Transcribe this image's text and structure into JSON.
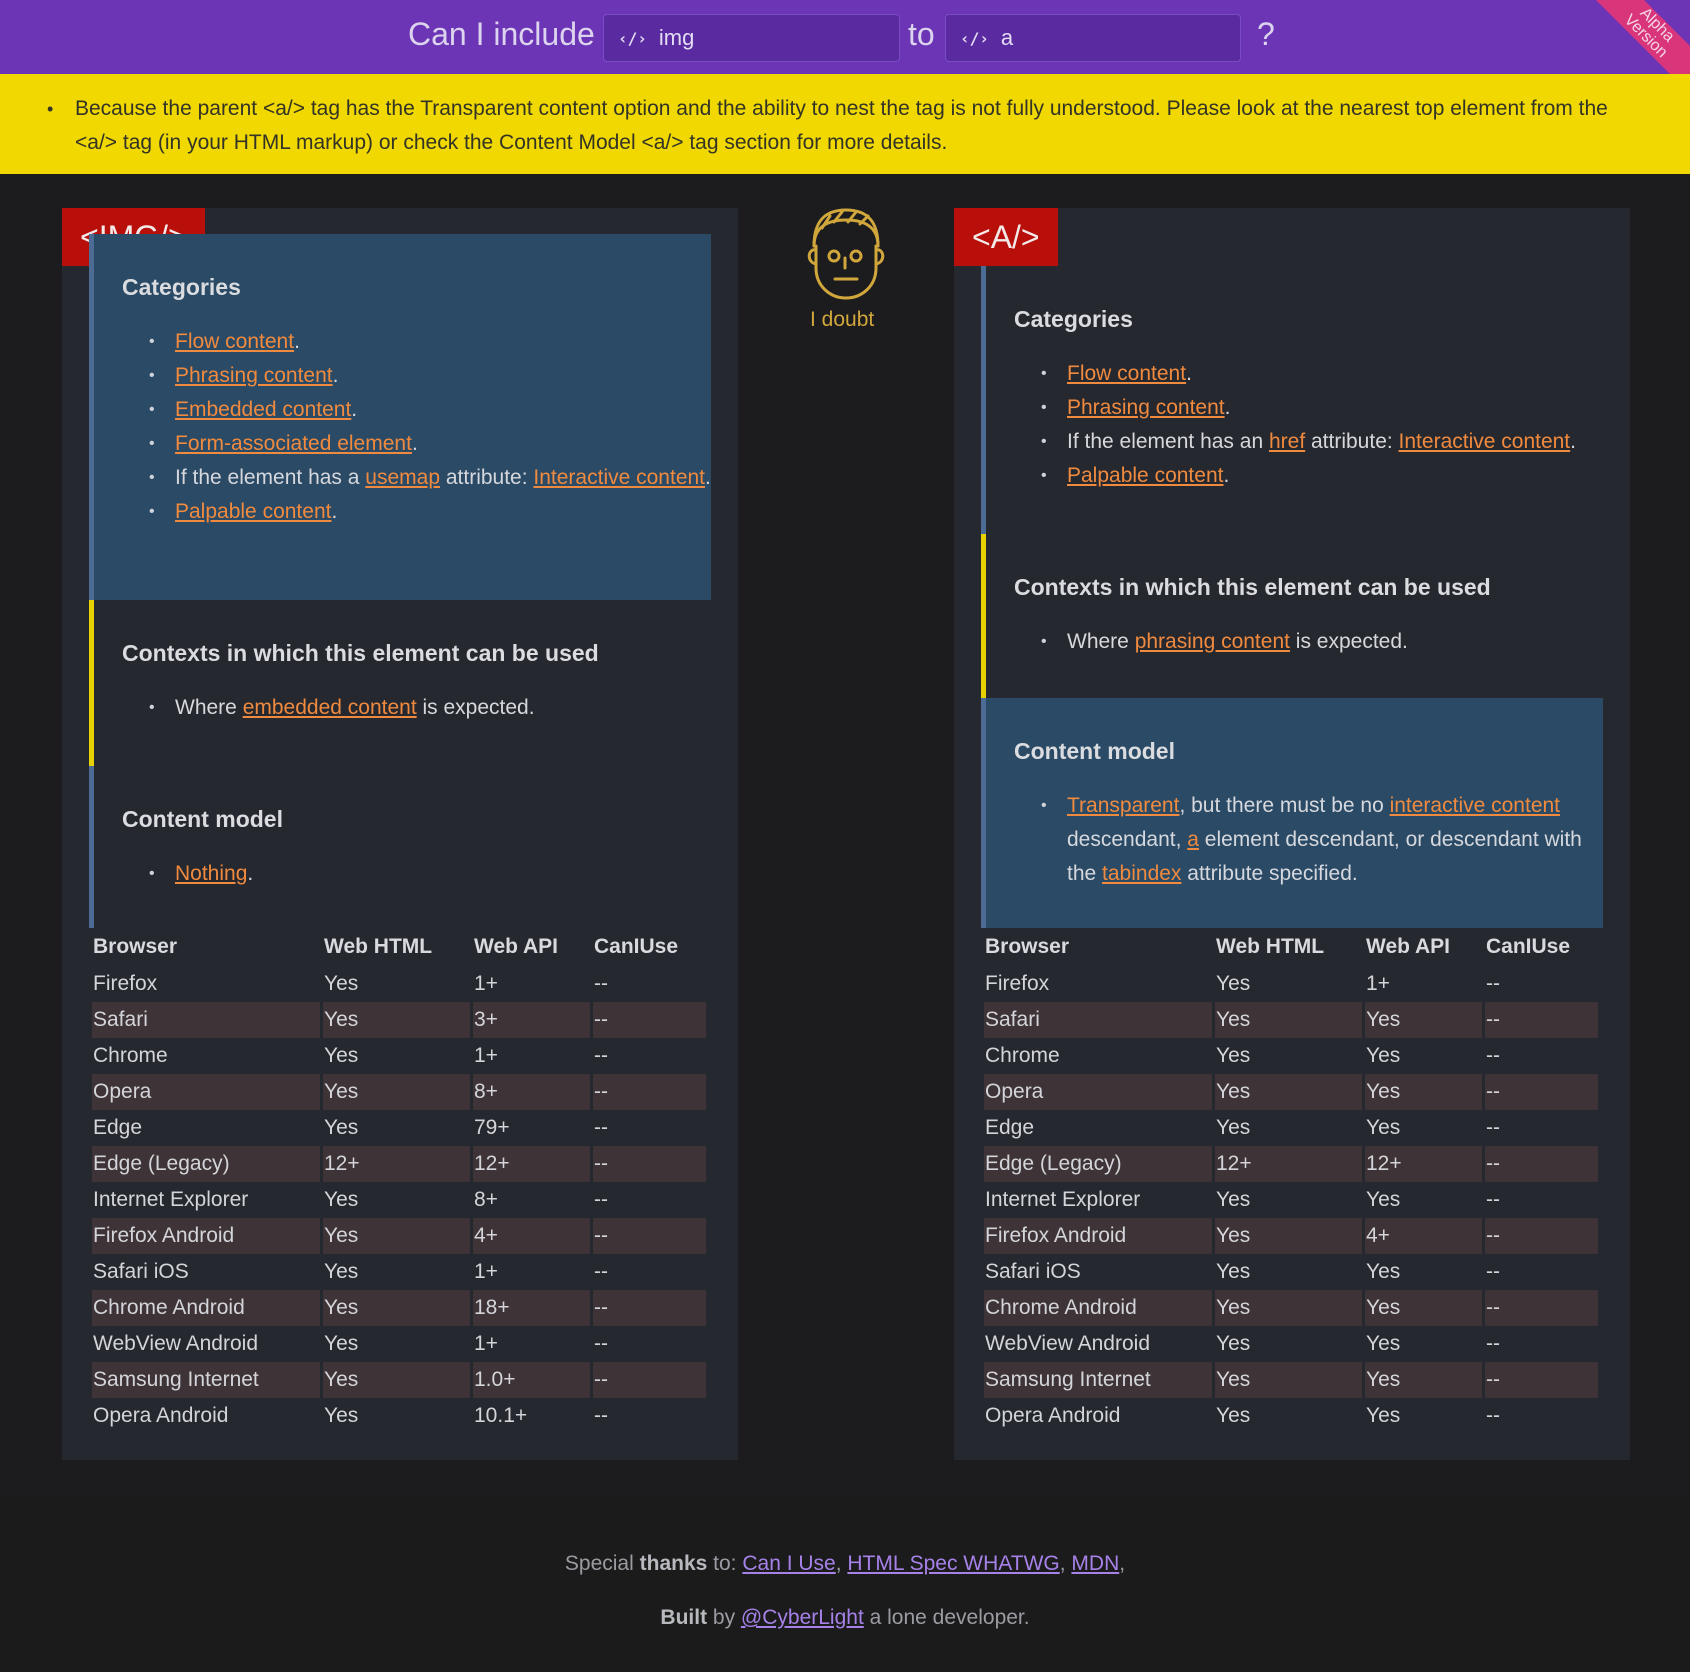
{
  "header": {
    "prefix": "Can I include",
    "child_tag": "img",
    "connector": "to",
    "parent_tag": "a",
    "question_mark": "?",
    "ribbon": "Alpha\nVersion"
  },
  "warning": {
    "message": "Because the parent <a/> tag has the Transparent content option and the ability to nest the tag is not fully understood. Please look at the nearest top element from the <a/> tag (in your HTML markup) or check the Content Model <a/> tag section for more details."
  },
  "verdict": {
    "label": "I doubt",
    "icon": "doubtful-face-icon"
  },
  "left": {
    "title": "<IMG/>",
    "categories_heading": "Categories",
    "cat1": "Flow content",
    "cat2": "Phrasing content",
    "cat3": "Embedded content",
    "cat4": "Form-associated element",
    "cat5_prefix": "If the element has a ",
    "cat5_attr": "usemap",
    "cat5_mid": " attribute: ",
    "cat5_link": "Interactive content",
    "cat6": "Palpable content",
    "contexts_heading": "Contexts in which this element can be used",
    "ctx_prefix": "Where ",
    "ctx_link": "embedded content",
    "ctx_suffix": " is expected.",
    "model_heading": "Content model",
    "model_link": "Nothing"
  },
  "right": {
    "title": "<A/>",
    "categories_heading": "Categories",
    "cat1": "Flow content",
    "cat2": "Phrasing content",
    "cat3_prefix": "If the element has an ",
    "cat3_attr": "href",
    "cat3_mid": " attribute: ",
    "cat3_link": "Interactive content",
    "cat4": "Palpable content",
    "contexts_heading": "Contexts in which this element can be used",
    "ctx_prefix": "Where ",
    "ctx_link": "phrasing content",
    "ctx_suffix": " is expected.",
    "model_heading": "Content model",
    "model_l1": "Transparent",
    "model_t1": ", but there must be no ",
    "model_l2": "interactive content",
    "model_t2": " descendant, ",
    "model_l3": "a",
    "model_t3": " element descendant, or descendant with the ",
    "model_l4": "tabindex",
    "model_t4": " attribute specified."
  },
  "table_headers": [
    "Browser",
    "Web HTML",
    "Web API",
    "CanIUse"
  ],
  "left_table": [
    [
      "Firefox",
      "Yes",
      "1+",
      "--"
    ],
    [
      "Safari",
      "Yes",
      "3+",
      "--"
    ],
    [
      "Chrome",
      "Yes",
      "1+",
      "--"
    ],
    [
      "Opera",
      "Yes",
      "8+",
      "--"
    ],
    [
      "Edge",
      "Yes",
      "79+",
      "--"
    ],
    [
      "Edge (Legacy)",
      "12+",
      "12+",
      "--"
    ],
    [
      "Internet Explorer",
      "Yes",
      "8+",
      "--"
    ],
    [
      "Firefox Android",
      "Yes",
      "4+",
      "--"
    ],
    [
      "Safari iOS",
      "Yes",
      "1+",
      "--"
    ],
    [
      "Chrome Android",
      "Yes",
      "18+",
      "--"
    ],
    [
      "WebView Android",
      "Yes",
      "1+",
      "--"
    ],
    [
      "Samsung Internet",
      "Yes",
      "1.0+",
      "--"
    ],
    [
      "Opera Android",
      "Yes",
      "10.1+",
      "--"
    ]
  ],
  "right_table": [
    [
      "Firefox",
      "Yes",
      "1+",
      "--"
    ],
    [
      "Safari",
      "Yes",
      "Yes",
      "--"
    ],
    [
      "Chrome",
      "Yes",
      "Yes",
      "--"
    ],
    [
      "Opera",
      "Yes",
      "Yes",
      "--"
    ],
    [
      "Edge",
      "Yes",
      "Yes",
      "--"
    ],
    [
      "Edge (Legacy)",
      "12+",
      "12+",
      "--"
    ],
    [
      "Internet Explorer",
      "Yes",
      "Yes",
      "--"
    ],
    [
      "Firefox Android",
      "Yes",
      "4+",
      "--"
    ],
    [
      "Safari iOS",
      "Yes",
      "Yes",
      "--"
    ],
    [
      "Chrome Android",
      "Yes",
      "Yes",
      "--"
    ],
    [
      "WebView Android",
      "Yes",
      "Yes",
      "--"
    ],
    [
      "Samsung Internet",
      "Yes",
      "Yes",
      "--"
    ],
    [
      "Opera Android",
      "Yes",
      "Yes",
      "--"
    ]
  ],
  "footer": {
    "special": "Special ",
    "thanks": "thanks",
    "to": " to: ",
    "link1": "Can I Use",
    "link2": "HTML Spec WHATWG",
    "link3": "MDN",
    "sep": ", ",
    "trail": ",",
    "built": "Built",
    "by": " by ",
    "author": "@CyberLight",
    "tail": " a lone developer."
  },
  "colors": {
    "header": "#6c35b6",
    "warning": "#f0d800",
    "tag_title": "#b80f0a",
    "link": "#f08a3e",
    "verdict": "#d1a73c",
    "footer_link": "#a682e8"
  }
}
